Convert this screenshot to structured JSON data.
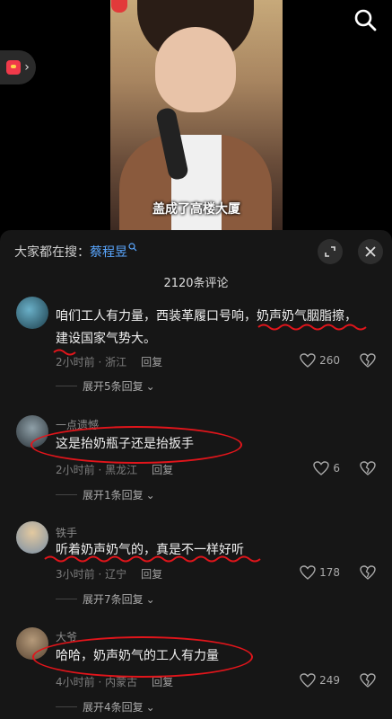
{
  "video": {
    "caption": "盖成了高楼大厦"
  },
  "panel": {
    "header_prefix": "大家都在搜：",
    "header_keyword": "蔡程昱",
    "comment_count": "2120条评论"
  },
  "comments": [
    {
      "username": "",
      "text": "咱们工人有力量，西装革履口号响，奶声奶气胭脂擦，建设国家气势大。",
      "time_location": "2小时前 · 浙江",
      "reply": "回复",
      "likes": "260",
      "expand": "展开5条回复"
    },
    {
      "username": "一点遗憾",
      "text": "这是抬奶瓶子还是抬扳手",
      "time_location": "2小时前 · 黑龙江",
      "reply": "回复",
      "likes": "6",
      "expand": "展开1条回复"
    },
    {
      "username": "铁手",
      "text": "听着奶声奶气的，真是不一样好听",
      "time_location": "3小时前 · 辽宁",
      "reply": "回复",
      "likes": "178",
      "expand": "展开7条回复"
    },
    {
      "username": "大爷",
      "text": "哈哈，奶声奶气的工人有力量",
      "time_location": "4小时前 · 内蒙古",
      "reply": "回复",
      "likes": "249",
      "expand": "展开4条回复"
    }
  ],
  "icons": {
    "search": "search-icon",
    "expand": "expand-icon",
    "close": "close-icon",
    "heart": "heart-icon",
    "dislike": "broken-heart-icon"
  },
  "colors": {
    "annotation": "#e1151b",
    "keyword": "#5aa7ff"
  }
}
